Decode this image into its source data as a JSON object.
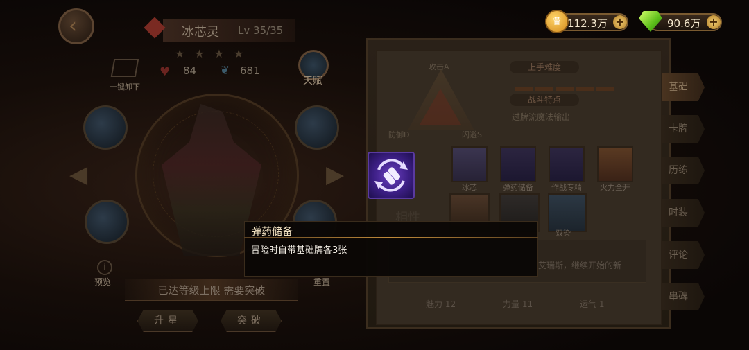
{
  "hero": {
    "name": "冰芯灵",
    "level": "Lv 35/35",
    "stars": "★★★★",
    "hp": "84",
    "attack": "681"
  },
  "left_actions": {
    "unequip_label": "一键卸下",
    "talent_label": "天赋",
    "preview_label": "预览",
    "reset_label": "重置",
    "max_level_text": "已达等级上限 需要突破",
    "upstar_label": "升星",
    "breakthrough_label": "突破"
  },
  "currency": {
    "gold_value": "112.3万",
    "gem_value": "90.6万"
  },
  "info_panel": {
    "attack_axis": "攻击A",
    "defense_axis": "防御D",
    "dodge_axis": "闪避S",
    "difficulty_header": "上手难度",
    "feature_header": "战斗特点",
    "feature_text": "过牌流魔法输出",
    "skill_row_label": "技",
    "affinity_row_label": "相性",
    "skill_cards": [
      "冰芯",
      "弹药储备",
      "作战专精",
      "火力全开"
    ],
    "affinity_card_label": "双染",
    "bio_fragment": "艾瑞斯，继续开始的新一",
    "stats": [
      "魅力 12",
      "力量 11",
      "运气 1"
    ]
  },
  "side_tabs": [
    "基础",
    "卡牌",
    "历练",
    "时装",
    "评论",
    "串碑"
  ],
  "tooltip": {
    "title": "弹药储备",
    "description": "冒险时自带基础牌各3张"
  },
  "colors": {
    "accent_gold": "#c08a3a",
    "skill_purple": "#3d1f86",
    "tooltip_bg": "#0a0705"
  }
}
